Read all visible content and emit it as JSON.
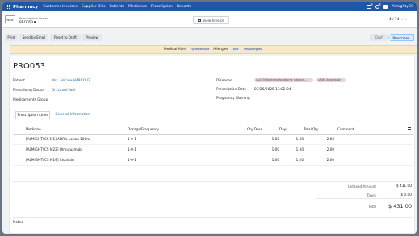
{
  "nav": {
    "app_name": "Pharmacy",
    "menus": [
      "Customer Invoices",
      "Supplier Bills",
      "Patients",
      "Medicines",
      "Prescription",
      "Reports"
    ],
    "chat_badge": "1",
    "activity_badge": "1",
    "company": "AlmightyCS"
  },
  "control": {
    "new_label": "New",
    "breadcrumb_parent": "Prescription Order",
    "breadcrumb_current": "PRO053",
    "view_invoice_label": "View Invoice",
    "pager": "4 / 74"
  },
  "actions": {
    "print": "Print",
    "send_email": "Send by Email",
    "reset_draft": "Reset to Draft",
    "preview": "Preview"
  },
  "stages": {
    "draft": "Draft",
    "prescribed": "Prescribed"
  },
  "alert": {
    "label": "Medical Alert",
    "alert_tag": "Hypertensive",
    "allergies_label": "Allergies",
    "allergy_tags": [
      "dust",
      "Pet Allergies"
    ]
  },
  "record": {
    "title": "PRO053",
    "patient_label": "Patient",
    "patient": "Mrs. Hocine HARROUZ",
    "doctor_label": "Prescribing Doctor",
    "doctor": "Dr. Laoni Pabl",
    "med_group_label": "Medicaments Group",
    "diseases_label": "Diseases",
    "diseases": [
      "(A03.9) Bacterial foodborne intoxica...",
      "(A06) Amoebiasis"
    ],
    "date_label": "Prescription Date",
    "date": "01/26/2025 13:02:04",
    "pregnancy_label": "Pregnancy Warning"
  },
  "tabs": {
    "lines": "Prescription Lines",
    "general": "General Information"
  },
  "lines": {
    "headers": {
      "medicine": "Medicine",
      "dosage": "Dosage/Frequency",
      "qty_dose": "Qty Dose",
      "days": "Days",
      "total_qty": "Total Qty",
      "comment": "Comment"
    },
    "rows": [
      {
        "medicine": "[ALMIGHTYCS M1] ADRIL Lotion 100ml",
        "dosage": "1-0-1",
        "qty_dose": "1.00",
        "days": "1.00",
        "total_qty": "2.00",
        "comment": ""
      },
      {
        "medicine": "[ALMIGHTYCS M22] Olmutuzmab",
        "dosage": "1-0-1",
        "qty_dose": "1.00",
        "days": "1.00",
        "total_qty": "2.00",
        "comment": ""
      },
      {
        "medicine": "[ALMIGHTYCS M19] Cisplatin",
        "dosage": "1-0-1",
        "qty_dose": "1.00",
        "days": "1.00",
        "total_qty": "2.00",
        "comment": ""
      }
    ]
  },
  "totals": {
    "untaxed_label": "Untaxed Amount",
    "untaxed": "$ 431.00",
    "taxes_label": "Taxes",
    "taxes": "$ 0.00",
    "total_label": "Total",
    "total": "$ 431.00"
  },
  "notes_label": "Notes"
}
